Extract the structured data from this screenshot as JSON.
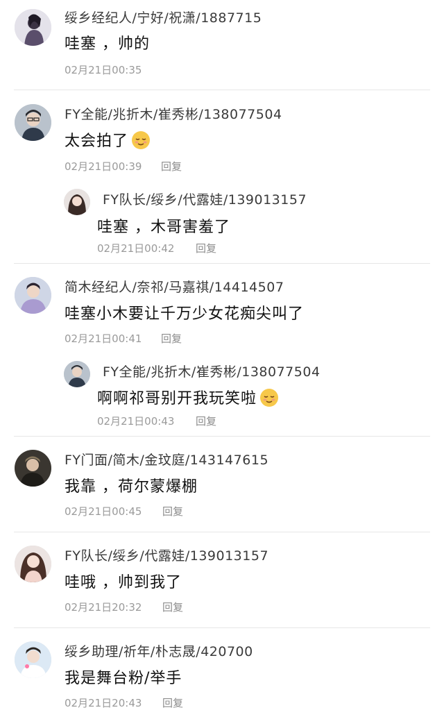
{
  "comments": [
    {
      "name": "绥乡经纪人/宁好/祝潇/1887715",
      "text": "哇塞 ，帅的",
      "time": "02月21日00:35",
      "reply_label": ""
    },
    {
      "name": "FY全能/兆折木/崔秀彬/138077504",
      "text": "太会拍了",
      "emoji": "relieved-face-emoji",
      "time": "02月21日00:39",
      "reply_label": "回复",
      "replies": [
        {
          "name": "FY队长/绥乡/代露娃/139013157",
          "text": "哇塞 ，木哥害羞了",
          "time": "02月21日00:42",
          "reply_label": "回复"
        }
      ]
    },
    {
      "name": "简木经纪人/奈祁/马嘉祺/14414507",
      "text": "哇塞小木要让千万少女花痴尖叫了",
      "time": "02月21日00:41",
      "reply_label": "回复",
      "replies": [
        {
          "name": "FY全能/兆折木/崔秀彬/138077504",
          "text": "啊啊祁哥别开我玩笑啦",
          "emoji": "relieved-face-emoji",
          "time": "02月21日00:43",
          "reply_label": "回复"
        }
      ]
    },
    {
      "name": "FY门面/简木/金玟庭/143147615",
      "text": "我靠 ，荷尔蒙爆棚",
      "time": "02月21日00:45",
      "reply_label": "回复"
    },
    {
      "name": "FY队长/绥乡/代露娃/139013157",
      "text": "哇哦 ，帅到我了",
      "time": "02月21日20:32",
      "reply_label": "回复"
    },
    {
      "name": "绥乡助理/祈年/朴志晟/420700",
      "text": "我是舞台粉/举手",
      "time": "02月21日20:43",
      "reply_label": "回复"
    }
  ],
  "colors": {
    "name": "#3a3a3a",
    "text": "#111111",
    "meta": "#9a9a9a",
    "divider": "#e6e6e6"
  }
}
